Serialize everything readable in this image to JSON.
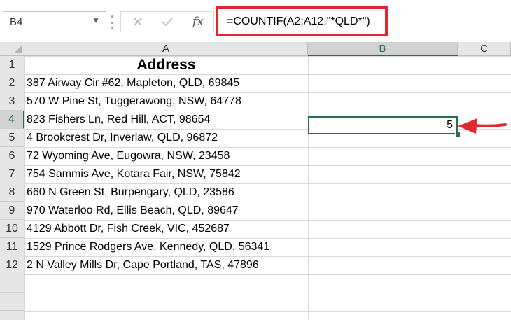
{
  "name_box": {
    "value": "B4"
  },
  "formula_bar": {
    "cancel_icon": "close-icon",
    "enter_icon": "check-icon",
    "function_label": "fx",
    "formula": "=COUNTIF(A2:A12,\"*QLD*\")"
  },
  "columns": [
    "A",
    "B",
    "C"
  ],
  "rows": [
    "1",
    "2",
    "3",
    "4",
    "5",
    "6",
    "7",
    "8",
    "9",
    "10",
    "11",
    "12"
  ],
  "sheet": {
    "header": "Address",
    "addresses": [
      "387 Airway Cir #62, Mapleton, QLD, 69845",
      "570 W Pine St, Tuggerawong, NSW, 64778",
      "823 Fishers Ln, Red Hill, ACT, 98654",
      "4 Brookcrest Dr, Inverlaw, QLD, 96872",
      "72 Wyoming Ave, Eugowra, NSW, 23458",
      "754 Sammis Ave, Kotara Fair, NSW, 75842",
      "660 N Green St, Burpengary, QLD, 23586",
      "970 Waterloo Rd, Ellis Beach, QLD, 89647",
      "4129 Abbott Dr, Fish Creek, VIC, 452687",
      "1529 Prince Rodgers Ave, Kennedy, QLD, 56341",
      "2 N Valley Mills Dr, Cape Portland, TAS, 47896"
    ],
    "result": "5"
  },
  "colors": {
    "accent": "#217346",
    "highlight_red": "#e2282e"
  }
}
